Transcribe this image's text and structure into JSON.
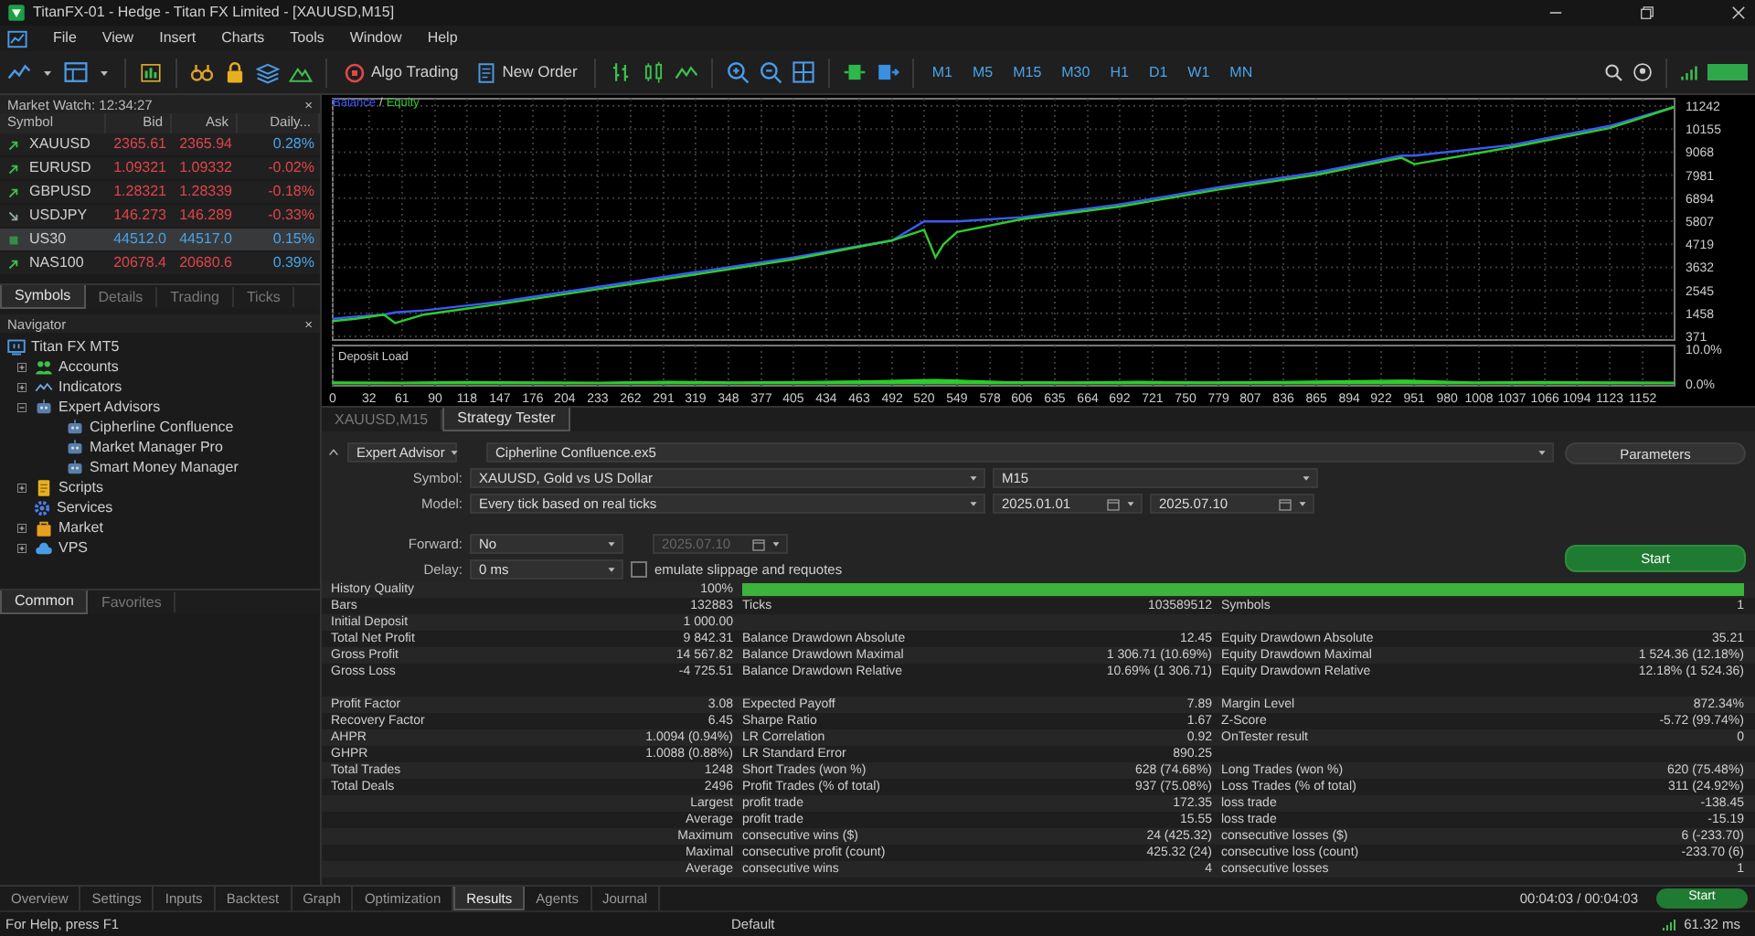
{
  "window": {
    "title": "TitanFX-01 - Hedge - Titan FX Limited - [XAUUSD,M15]"
  },
  "menu": [
    "File",
    "View",
    "Insert",
    "Charts",
    "Tools",
    "Window",
    "Help"
  ],
  "toolbar": {
    "buttons": [
      "Algo Trading",
      "New Order"
    ],
    "timeframes": [
      "M1",
      "M5",
      "M15",
      "M30",
      "H1",
      "D1",
      "W1",
      "MN"
    ]
  },
  "market_watch": {
    "title": "Market Watch: 12:34:27",
    "close": "×",
    "columns": [
      "Symbol",
      "Bid",
      "Ask",
      "Daily..."
    ],
    "rows": [
      {
        "kind": "rising",
        "symbol": "XAUUSD",
        "bid": "2365.61",
        "ask": "2365.94",
        "daily": "0.28%",
        "price_up": false,
        "daily_up": true,
        "selected": false
      },
      {
        "kind": "rising",
        "symbol": "EURUSD",
        "bid": "1.09321",
        "ask": "1.09332",
        "daily": "-0.02%",
        "price_up": false,
        "daily_up": false,
        "selected": false
      },
      {
        "kind": "rising",
        "symbol": "GBPUSD",
        "bid": "1.28321",
        "ask": "1.28339",
        "daily": "-0.18%",
        "price_up": false,
        "daily_up": false,
        "selected": false
      },
      {
        "kind": "falling",
        "symbol": "USDJPY",
        "bid": "146.273",
        "ask": "146.289",
        "daily": "-0.33%",
        "price_up": false,
        "daily_up": false,
        "selected": false
      },
      {
        "kind": "flat",
        "symbol": "US30",
        "bid": "44512.0",
        "ask": "44517.0",
        "daily": "0.15%",
        "price_up": true,
        "daily_up": true,
        "selected": true
      },
      {
        "kind": "rising",
        "symbol": "NAS100",
        "bid": "20678.4",
        "ask": "20680.6",
        "daily": "0.39%",
        "price_up": false,
        "daily_up": true,
        "selected": false
      }
    ],
    "tabs": [
      {
        "label": "Symbols",
        "selected": true
      },
      {
        "label": "Details",
        "selected": false
      },
      {
        "label": "Trading",
        "selected": false
      },
      {
        "label": "Ticks",
        "selected": false
      }
    ]
  },
  "navigator": {
    "title": "Navigator",
    "close": "×",
    "tree": [
      {
        "label": "Titan FX MT5",
        "children": [
          {
            "label": "Accounts",
            "expanded": false
          },
          {
            "label": "Indicators",
            "expanded": false
          },
          {
            "label": "Expert Advisors",
            "expanded": true,
            "children": [
              {
                "label": "Cipherline Confluence"
              },
              {
                "label": "Market Manager Pro"
              },
              {
                "label": "Smart Money Manager"
              }
            ]
          },
          {
            "label": "Scripts",
            "expanded": false
          },
          {
            "label": "Services"
          },
          {
            "label": "Market",
            "expanded": false
          },
          {
            "label": "VPS",
            "expanded": false
          }
        ]
      }
    ],
    "tabs": [
      {
        "label": "Common",
        "selected": true
      },
      {
        "label": "Favorites",
        "selected": false
      }
    ]
  },
  "chart": {
    "legend_separator": "/",
    "chart_data": {
      "type": "line",
      "grid": true,
      "xlim": [
        0,
        1180
      ],
      "ylim": [
        371,
        11242
      ],
      "yticks": [
        371,
        1458,
        2545,
        3632,
        4719,
        5807,
        6894,
        7981,
        9068,
        10155,
        11242
      ],
      "x": [
        0,
        20,
        45,
        55,
        80,
        147,
        233,
        319,
        405,
        492,
        520,
        530,
        537,
        549,
        606,
        692,
        779,
        865,
        940,
        951,
        1037,
        1123,
        1180
      ],
      "series": [
        {
          "name": "Balance",
          "color": "#3b5bff",
          "values": [
            1200,
            1300,
            1400,
            1500,
            1600,
            2000,
            2700,
            3400,
            4100,
            4900,
            5800,
            5800,
            5800,
            5800,
            6000,
            6600,
            7400,
            8100,
            8900,
            8900,
            9400,
            10300,
            11200
          ]
        },
        {
          "name": "Equity",
          "color": "#2ecc2e",
          "values": [
            1100,
            1200,
            1400,
            1000,
            1400,
            1900,
            2600,
            3300,
            4000,
            4900,
            5400,
            4100,
            4700,
            5300,
            5900,
            6500,
            7300,
            8000,
            8800,
            8500,
            9300,
            10200,
            11200
          ]
        }
      ]
    },
    "deposit_load": {
      "chart_data": {
        "type": "area",
        "grid": true,
        "xlim": [
          0,
          1180
        ],
        "ylim": [
          0,
          10
        ],
        "yticks": [
          {
            "value": 0,
            "label": "0.0%"
          },
          {
            "value": 10,
            "label": "10.0%"
          }
        ],
        "xticks": [
          0,
          32,
          61,
          90,
          118,
          147,
          176,
          204,
          233,
          262,
          291,
          319,
          348,
          377,
          405,
          434,
          463,
          492,
          520,
          549,
          578,
          606,
          635,
          664,
          692,
          721,
          750,
          779,
          807,
          836,
          865,
          894,
          922,
          951,
          980,
          1008,
          1037,
          1066,
          1094,
          1123,
          1152
        ],
        "x": [
          0,
          59,
          118,
          177,
          236,
          295,
          354,
          413,
          472,
          531,
          590,
          649,
          708,
          767,
          826,
          885,
          944,
          1003,
          1062,
          1121,
          1180
        ],
        "series": [
          {
            "name": "Deposit Load",
            "color": "#2ecc2e",
            "values": [
              0.6,
              0.5,
              0.7,
              0.6,
              0.5,
              0.8,
              0.6,
              0.7,
              0.9,
              1.3,
              0.7,
              0.6,
              0.8,
              0.6,
              0.7,
              0.9,
              1.1,
              0.6,
              0.7,
              0.6,
              0.5
            ]
          }
        ]
      }
    }
  },
  "chart_tabs": [
    {
      "label": "XAUUSD,M15",
      "selected": false
    },
    {
      "label": "Strategy Tester",
      "selected": true
    }
  ],
  "tester": {
    "mode": "Expert Advisor",
    "expert": "Cipherline Confluence.ex5",
    "parameters": "Parameters",
    "symbol_label": "Symbol:",
    "symbol": "XAUUSD, Gold vs US Dollar",
    "timeframe": "M15",
    "model_label": "Model:",
    "model": "Every tick based on real ticks",
    "date_from": "2025.01.01",
    "date_to": "2025.07.10",
    "forward_label": "Forward:",
    "forward": "No",
    "forward_date": {
      "value": "2025.07.10",
      "disabled": true
    },
    "delay_label": "Delay:",
    "delay": "0 ms",
    "slippage": {
      "label": "emulate slippage and requotes",
      "checked": false
    },
    "start": "Start"
  },
  "results": {
    "history_quality": {
      "label": "History Quality",
      "value": "100%",
      "level": 1
    },
    "summary_rows": [
      {
        "cells": [
          "Bars",
          "132883",
          "Ticks",
          "103589512",
          "Symbols",
          "1"
        ]
      },
      {
        "cells": [
          "Initial Deposit",
          "1 000.00"
        ]
      },
      {
        "cells": [
          "Total Net Profit",
          "9 842.31",
          "Balance Drawdown Absolute",
          "12.45",
          "Equity Drawdown Absolute",
          "35.21"
        ]
      },
      {
        "cells": [
          "Gross Profit",
          "14 567.82",
          "Balance Drawdown Maximal",
          "1 306.71 (10.69%)",
          "Equity Drawdown Maximal",
          "1 524.36 (12.18%)"
        ]
      },
      {
        "cells": [
          "Gross Loss",
          "-4 725.51",
          "Balance Drawdown Relative",
          "10.69% (1 306.71)",
          "Equity Drawdown Relative",
          "12.18% (1 524.36)"
        ]
      }
    ],
    "trade_rows": [
      {
        "cells": [
          "Profit Factor",
          "3.08",
          "Expected Payoff",
          "7.89",
          "Margin Level",
          "872.34%"
        ]
      },
      {
        "cells": [
          "Recovery Factor",
          "6.45",
          "Sharpe Ratio",
          "1.67",
          "Z-Score",
          "-5.72 (99.74%)"
        ]
      },
      {
        "cells": [
          "AHPR",
          "1.0094 (0.94%)",
          "LR Correlation",
          "0.92",
          "OnTester result",
          "0"
        ]
      },
      {
        "cells": [
          "GHPR",
          "1.0088 (0.88%)",
          "LR Standard Error",
          "890.25"
        ]
      },
      {
        "cells": [
          "Total Trades",
          "1248",
          "Short Trades (won %)",
          "628 (74.68%)",
          "Long Trades (won %)",
          "620 (75.48%)"
        ]
      },
      {
        "cells": [
          "Total Deals",
          "2496",
          "Profit Trades (% of total)",
          "937 (75.08%)",
          "Loss Trades (% of total)",
          "311 (24.92%)"
        ]
      },
      {
        "group": "Largest",
        "cells": [
          "profit trade",
          "172.35",
          "loss trade",
          "-138.45"
        ]
      },
      {
        "group": "Average",
        "cells": [
          "profit trade",
          "15.55",
          "loss trade",
          "-15.19"
        ]
      },
      {
        "group": "Maximum",
        "cells": [
          "consecutive wins ($)",
          "24 (425.32)",
          "consecutive losses ($)",
          "6 (-233.70)"
        ]
      },
      {
        "group": "Maximal",
        "cells": [
          "consecutive profit (count)",
          "425.32 (24)",
          "consecutive loss (count)",
          "-233.70 (6)"
        ]
      },
      {
        "group": "Average",
        "cells": [
          "consecutive wins",
          "4",
          "consecutive losses",
          "1"
        ]
      }
    ]
  },
  "bottom_tabs": [
    {
      "label": "Overview",
      "selected": false
    },
    {
      "label": "Settings",
      "selected": false
    },
    {
      "label": "Inputs",
      "selected": false
    },
    {
      "label": "Backtest",
      "selected": false
    },
    {
      "label": "Graph",
      "selected": false
    },
    {
      "label": "Optimization",
      "selected": false
    },
    {
      "label": "Results",
      "selected": true
    },
    {
      "label": "Agents",
      "selected": false
    },
    {
      "label": "Journal",
      "selected": false
    }
  ],
  "elapsed": "00:04:03 / 00:04:03",
  "start_button": "Start",
  "status_bar": {
    "help": "For Help, press F1",
    "profile": "Default",
    "ping": "61.32 ms"
  }
}
